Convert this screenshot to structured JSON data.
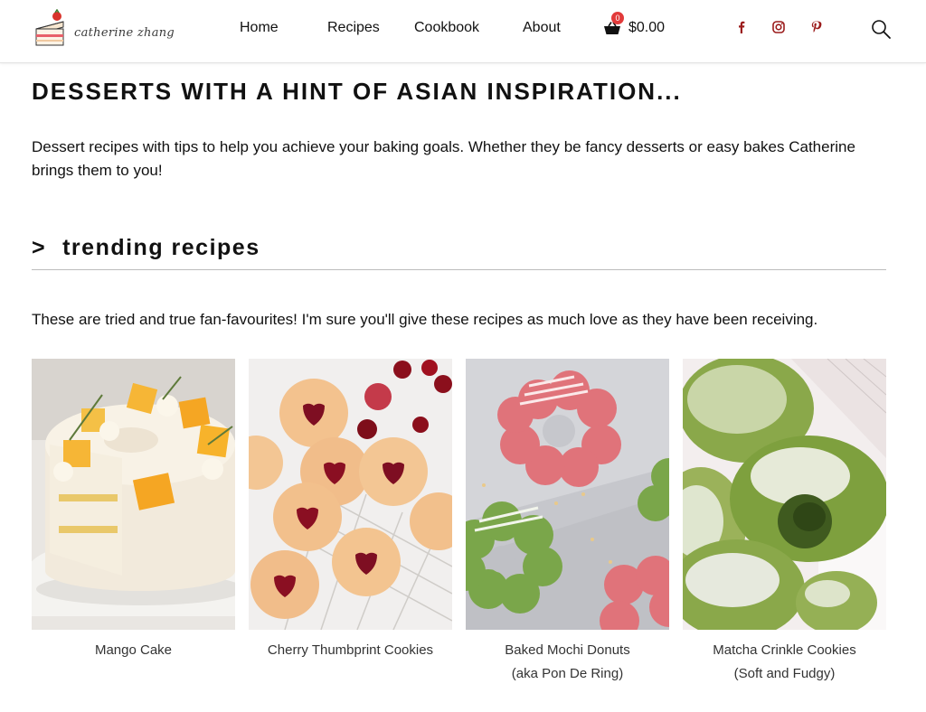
{
  "header": {
    "logo_text": "catherine zhang",
    "nav": [
      "Home",
      "Recipes",
      "Cookbook",
      "About"
    ],
    "cart": {
      "count": "0",
      "total": "$0.00"
    },
    "social": [
      "facebook-icon",
      "instagram-icon",
      "pinterest-icon"
    ],
    "accent_color": "#9b1c1c"
  },
  "main": {
    "title": "DESSERTS WITH A HINT OF ASIAN INSPIRATION...",
    "intro": "Dessert recipes with tips to help you achieve your baking goals. Whether they be fancy desserts or easy bakes Catherine brings them to you!",
    "trending": {
      "chevron": ">",
      "heading": "trending recipes",
      "description": "These are tried and true fan-favourites! I'm sure you'll give these recipes as much love as they have been receiving."
    },
    "recipes": [
      {
        "line1": "Mango Cake",
        "line2": ""
      },
      {
        "line1": "Cherry Thumbprint Cookies",
        "line2": ""
      },
      {
        "line1": "Baked Mochi Donuts",
        "line2": "(aka Pon De Ring)"
      },
      {
        "line1": "Matcha Crinkle Cookies",
        "line2": "(Soft and Fudgy)"
      }
    ]
  }
}
